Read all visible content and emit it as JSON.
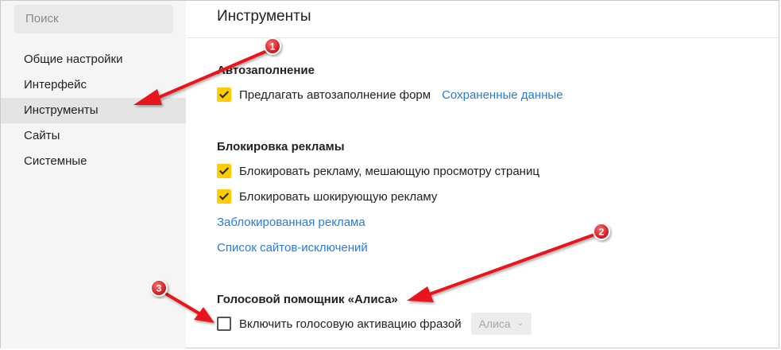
{
  "search": {
    "placeholder": "Поиск"
  },
  "sidebar": {
    "items": [
      {
        "label": "Общие настройки",
        "active": false
      },
      {
        "label": "Интерфейс",
        "active": false
      },
      {
        "label": "Инструменты",
        "active": true
      },
      {
        "label": "Сайты",
        "active": false
      },
      {
        "label": "Системные",
        "active": false
      }
    ]
  },
  "main": {
    "title": "Инструменты",
    "autofill": {
      "title": "Автозаполнение",
      "option_label": "Предлагать автозаполнение форм",
      "option_checked": true,
      "saved_data_link": "Сохраненные данные"
    },
    "adblock": {
      "title": "Блокировка рекламы",
      "options": [
        {
          "label": "Блокировать рекламу, мешающую просмотру страниц",
          "checked": true
        },
        {
          "label": "Блокировать шокирующую рекламу",
          "checked": true
        }
      ],
      "blocked_link": "Заблокированная реклама",
      "exceptions_link": "Список сайтов-исключений"
    },
    "voice": {
      "title": "Голосовой помощник «Алиса»",
      "option_label": "Включить голосовую активацию фразой",
      "option_checked": false,
      "phrase_select": "Алиса"
    }
  },
  "annotations": {
    "badges": [
      "1",
      "2",
      "3"
    ]
  },
  "colors": {
    "accent_checkbox": "#ffcc00",
    "link": "#2b7bd6",
    "annotation_red": "#e8141b"
  }
}
